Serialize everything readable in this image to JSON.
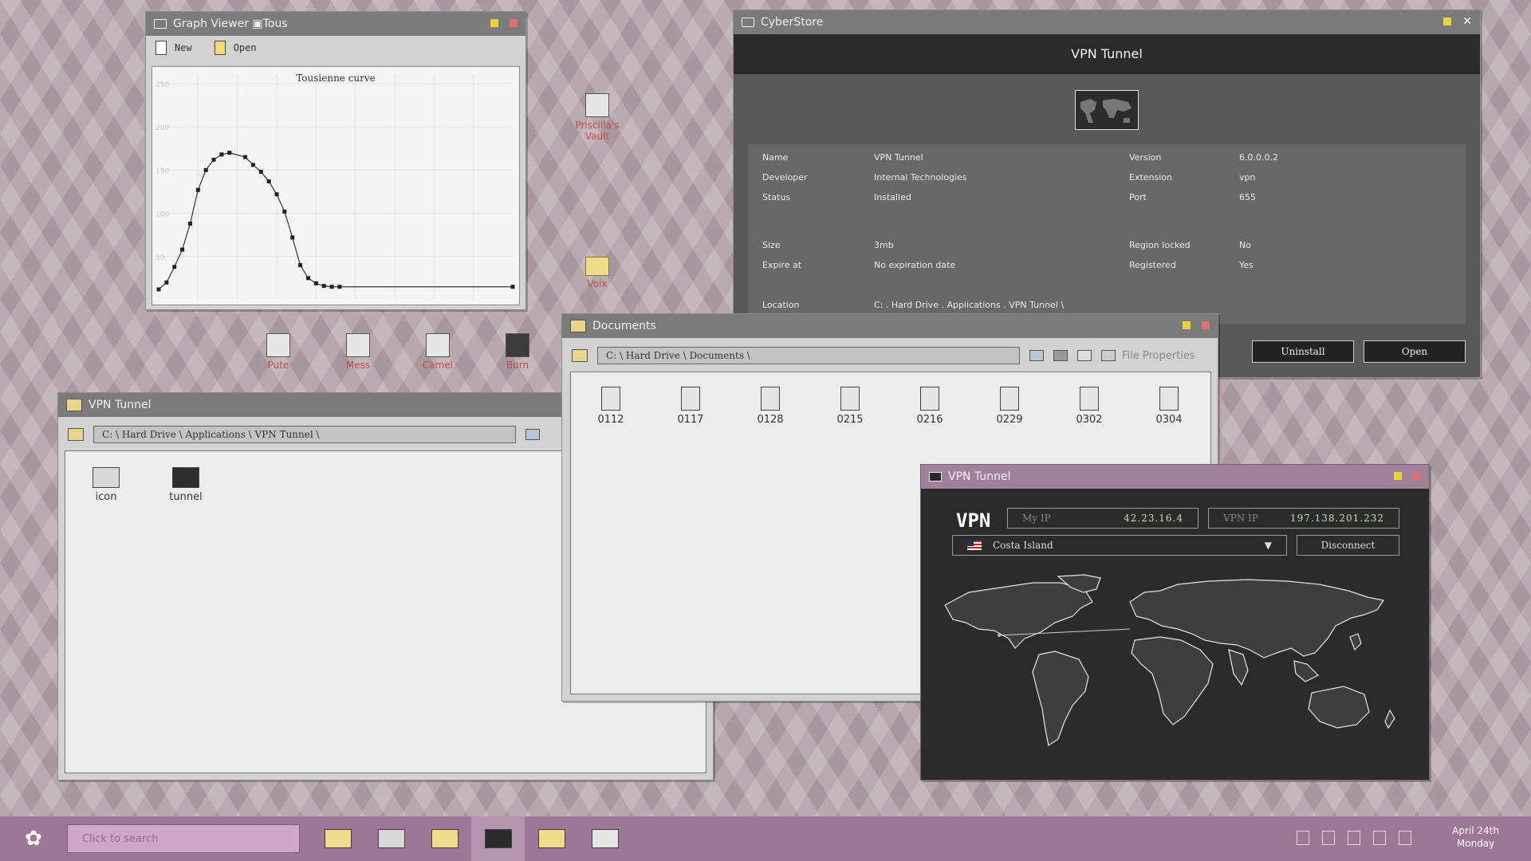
{
  "colors": {
    "taskbar": "#9c7896",
    "search_bg": "#d0a6c9",
    "title_bar": "#7b7b7b",
    "vpn_title_bar": "#a1809b",
    "minimize": "#e9d23d",
    "close": "#e07070",
    "desktop_label": "#c24b4b"
  },
  "graph_window": {
    "title": "Graph Viewer ▣Tous",
    "toolbar": {
      "new_label": "New",
      "open_label": "Open"
    },
    "chart_title": "Tousienne curve"
  },
  "chart_data": {
    "type": "line",
    "title": "Tousienne curve",
    "xlabel": "",
    "ylabel": "",
    "ylim": [
      0,
      260
    ],
    "xlim": [
      0,
      45
    ],
    "y_ticks": [
      50,
      100,
      150,
      200,
      250
    ],
    "grid": true,
    "x": [
      0,
      1,
      2,
      3,
      4,
      5,
      6,
      7,
      8,
      9,
      11,
      12,
      13,
      14,
      15,
      16,
      17,
      18,
      19,
      20,
      21,
      22,
      23,
      45
    ],
    "values": [
      12,
      20,
      38,
      58,
      88,
      127,
      150,
      162,
      168,
      170,
      165,
      156,
      148,
      137,
      122,
      102,
      72,
      40,
      25,
      19,
      16,
      15,
      15,
      15
    ]
  },
  "desktop_icons": [
    {
      "label": "Priscilla's Vault",
      "icon": "computer-icon"
    },
    {
      "label": "Voix",
      "icon": "folder-icon"
    },
    {
      "label": "Pute",
      "icon": "laptop-icon"
    },
    {
      "label": "Mess",
      "icon": "notepad-icon"
    },
    {
      "label": "Camel",
      "icon": "document-icon"
    },
    {
      "label": "Burn",
      "icon": "terminal-icon"
    }
  ],
  "store": {
    "title": "CyberStore",
    "header": "VPN Tunnel",
    "fields": {
      "name_label": "Name",
      "name": "VPN Tunnel",
      "developer_label": "Developer",
      "developer": "Internal Technologies",
      "status_label": "Status",
      "status": "Installed",
      "version_label": "Version",
      "version": "6.0.0.0.2",
      "extension_label": "Extension",
      "extension": "vpn",
      "port_label": "Port",
      "port": "655",
      "size_label": "Size",
      "size": "3mb",
      "expire_label": "Expire at",
      "expire": "No expiration date",
      "region_label": "Region locked",
      "region": "No",
      "registered_label": "Registered",
      "registered": "Yes",
      "location_label": "Location",
      "location": "C: . Hard Drive . Applications . VPN Tunnel \\"
    },
    "uninstall_label": "Uninstall",
    "open_label": "Open"
  },
  "vpn_folder": {
    "title": "VPN Tunnel",
    "path": "C: \\ Hard Drive \\ Applications \\ VPN Tunnel \\",
    "files": [
      "icon",
      "tunnel"
    ]
  },
  "documents": {
    "title": "Documents",
    "path": "C: \\ Hard Drive \\ Documents \\",
    "file_properties_label": "File Properties",
    "files": [
      "0112",
      "0117",
      "0128",
      "0215",
      "0216",
      "0229",
      "0302",
      "0304"
    ]
  },
  "vpn_app": {
    "title": "VPN Tunnel",
    "logo": "VPN",
    "my_ip_label": "My IP",
    "my_ip": "42.23.16.4",
    "vpn_ip_label": "VPN IP",
    "vpn_ip": "197.138.201.232",
    "country": "Costa Island",
    "disconnect_label": "Disconnect"
  },
  "taskbar": {
    "search_placeholder": "Click to search",
    "apps": [
      "folder-icon",
      "laptop-icon",
      "folder-icon",
      "vpn-map-icon",
      "folder-icon",
      "graph-icon"
    ],
    "date": "April 24th",
    "day": "Monday"
  }
}
